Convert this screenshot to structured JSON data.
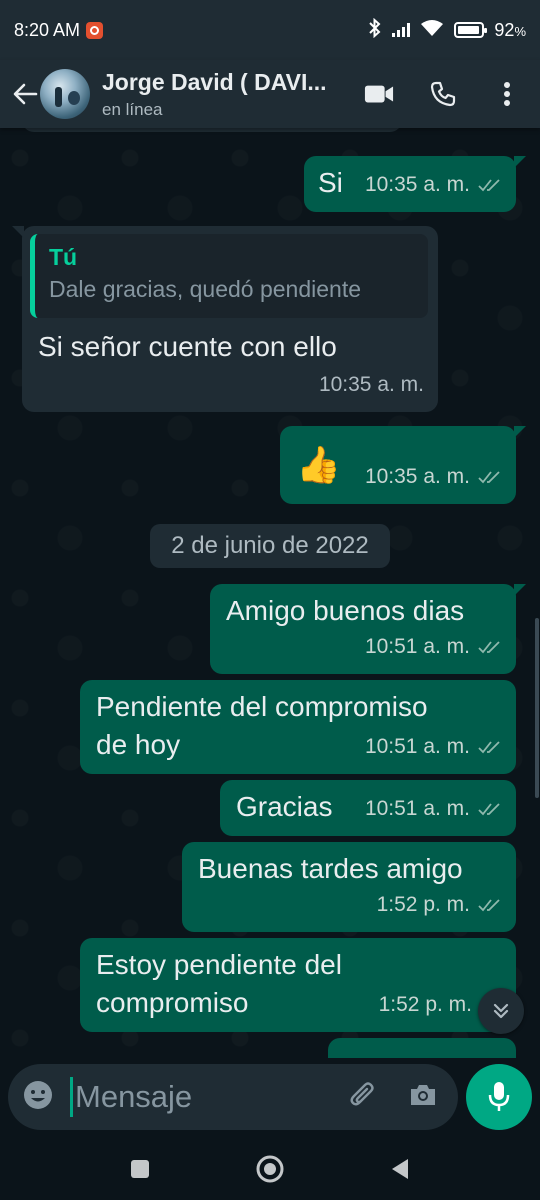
{
  "status_bar": {
    "time": "8:20 AM",
    "battery": "92",
    "battery_fraction": 0.92
  },
  "header": {
    "name": "Jorge David ( DAVI...",
    "status": "en línea"
  },
  "colors": {
    "outgoing": "#005c4b",
    "incoming": "#1f2c34",
    "accent": "#00a884",
    "quote_bar": "#06cf9c"
  },
  "messages": [
    {
      "type": "out",
      "text": "Si",
      "time": "10:35 a. m."
    },
    {
      "type": "in",
      "quote_author": "Tú",
      "quote_text": "Dale gracias, quedó pendiente",
      "text": "Si señor cuente con ello",
      "time": "10:35 a. m."
    },
    {
      "type": "out",
      "text": "👍",
      "time": "10:35 a. m."
    },
    {
      "type": "out",
      "text": "Amigo buenos dias",
      "time": "10:51 a. m."
    },
    {
      "type": "out",
      "text_line1": "Pendiente del compromiso",
      "text_line2": "de hoy",
      "time": "10:51 a. m."
    },
    {
      "type": "out",
      "text": "Gracias",
      "time": "10:51 a. m."
    },
    {
      "type": "out",
      "text": "Buenas tardes amigo",
      "time": "1:52 p. m."
    },
    {
      "type": "out",
      "text_line1": "Estoy pendiente del",
      "text_line2": "compromiso",
      "time": "1:52 p. m."
    }
  ],
  "date_chip": "2 de junio de 2022",
  "input": {
    "placeholder": "Mensaje"
  },
  "icons": [
    "back-arrow-icon",
    "video-call-icon",
    "phone-icon",
    "more-options-icon",
    "emoji-icon",
    "attach-icon",
    "camera-icon",
    "mic-icon",
    "scroll-down-icon",
    "nav-recents-icon",
    "nav-home-icon",
    "nav-back-icon"
  ]
}
